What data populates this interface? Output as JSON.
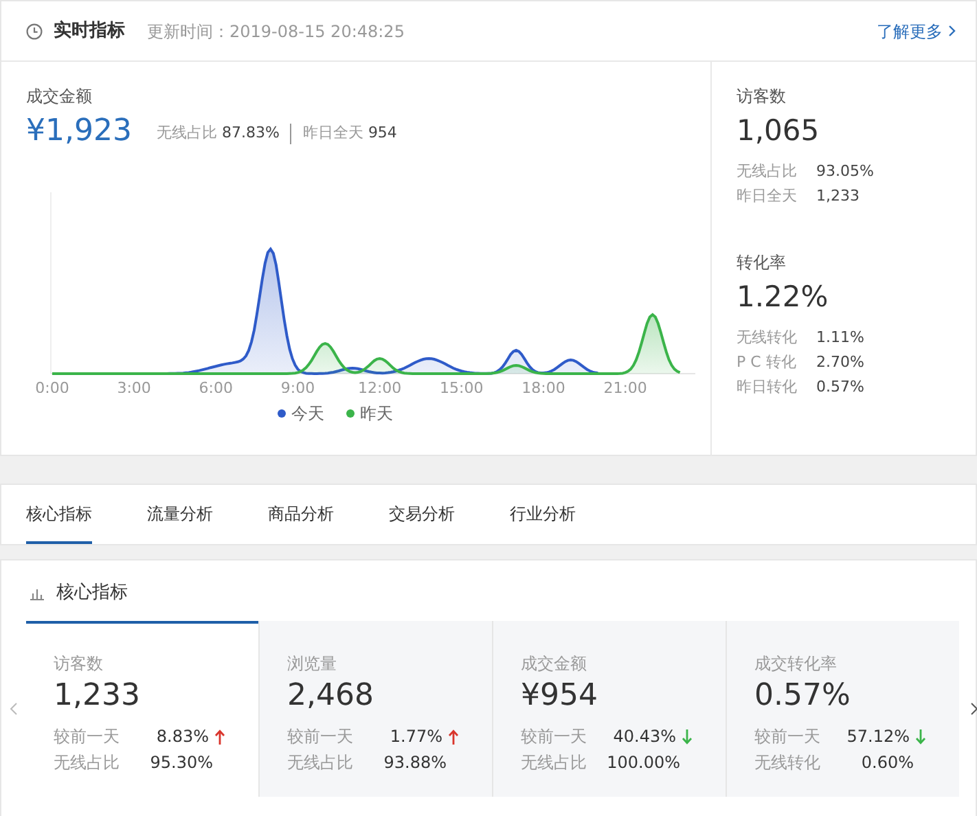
{
  "header": {
    "title": "实时指标",
    "updated": "更新时间：2019-08-15 20:48:25",
    "more_link": "了解更多"
  },
  "main_metric": {
    "label": "成交金额",
    "value": "¥1,923",
    "details": [
      {
        "label": "无线占比",
        "value": "87.83%"
      },
      {
        "label": "昨日全天",
        "value": "954"
      }
    ]
  },
  "chart": {
    "x_labels": [
      "0:00",
      "3:00",
      "6:00",
      "9:00",
      "12:00",
      "15:00",
      "18:00",
      "21:00"
    ],
    "legend": [
      {
        "label": "今天",
        "color": "#2f5bc9"
      },
      {
        "label": "昨天",
        "color": "#3bb44a"
      }
    ]
  },
  "side_metrics": [
    {
      "label": "访客数",
      "value": "1,065",
      "details": [
        {
          "label": "无线占比",
          "value": "93.05%"
        },
        {
          "label": "昨日全天",
          "value": "1,233"
        }
      ]
    },
    {
      "label": "转化率",
      "value": "1.22%",
      "details": [
        {
          "label": "无线转化",
          "value": "1.11%"
        },
        {
          "label": "P C 转化",
          "value": "2.70%"
        },
        {
          "label": "昨日转化",
          "value": "0.57%"
        }
      ]
    }
  ],
  "tabs": [
    {
      "label": "核心指标",
      "selected": true
    },
    {
      "label": "流量分析",
      "selected": false
    },
    {
      "label": "商品分析",
      "selected": false
    },
    {
      "label": "交易分析",
      "selected": false
    },
    {
      "label": "行业分析",
      "selected": false
    }
  ],
  "core": {
    "title": "核心指标",
    "cards": [
      {
        "label": "访客数",
        "value": "1,233",
        "selected": true,
        "rows": [
          {
            "label": "较前一天",
            "value": "8.83%",
            "kind": "rise"
          },
          {
            "label": "无线占比",
            "value": "95.30%"
          }
        ]
      },
      {
        "label": "浏览量",
        "value": "2,468",
        "selected": false,
        "rows": [
          {
            "label": "较前一天",
            "value": "1.77%",
            "kind": "rise"
          },
          {
            "label": "无线占比",
            "value": "93.88%"
          }
        ]
      },
      {
        "label": "成交金额",
        "value": "¥954",
        "selected": false,
        "rows": [
          {
            "label": "较前一天",
            "value": "40.43%",
            "kind": "fall"
          },
          {
            "label": "无线占比",
            "value": "100.00%"
          }
        ]
      },
      {
        "label": "成交转化率",
        "value": "0.57%",
        "selected": false,
        "rows": [
          {
            "label": "较前一天",
            "value": "57.12%",
            "kind": "fall"
          },
          {
            "label": "无线转化",
            "value": "0.60%"
          }
        ]
      }
    ]
  }
}
